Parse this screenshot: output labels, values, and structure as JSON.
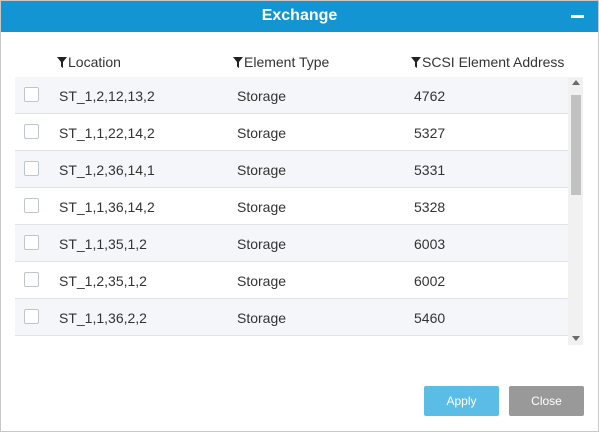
{
  "dialog": {
    "title": "Exchange"
  },
  "columns": {
    "location": "Location",
    "element_type": "Element Type",
    "scsi_address": "SCSI Element Address"
  },
  "rows": [
    {
      "location": "ST_1,2,12,13,2",
      "type": "Storage",
      "address": "4762"
    },
    {
      "location": "ST_1,1,22,14,2",
      "type": "Storage",
      "address": "5327"
    },
    {
      "location": "ST_1,2,36,14,1",
      "type": "Storage",
      "address": "5331"
    },
    {
      "location": "ST_1,1,36,14,2",
      "type": "Storage",
      "address": "5328"
    },
    {
      "location": "ST_1,1,35,1,2",
      "type": "Storage",
      "address": "6003"
    },
    {
      "location": "ST_1,2,35,1,2",
      "type": "Storage",
      "address": "6002"
    },
    {
      "location": "ST_1,1,36,2,2",
      "type": "Storage",
      "address": "5460"
    }
  ],
  "buttons": {
    "apply": "Apply",
    "close": "Close"
  },
  "colors": {
    "title_bar": "#1395d4",
    "apply": "#5bbce6",
    "close": "#999999"
  },
  "icons": {
    "column_filter": "filter-icon",
    "window_minimize": "minimize-icon"
  }
}
